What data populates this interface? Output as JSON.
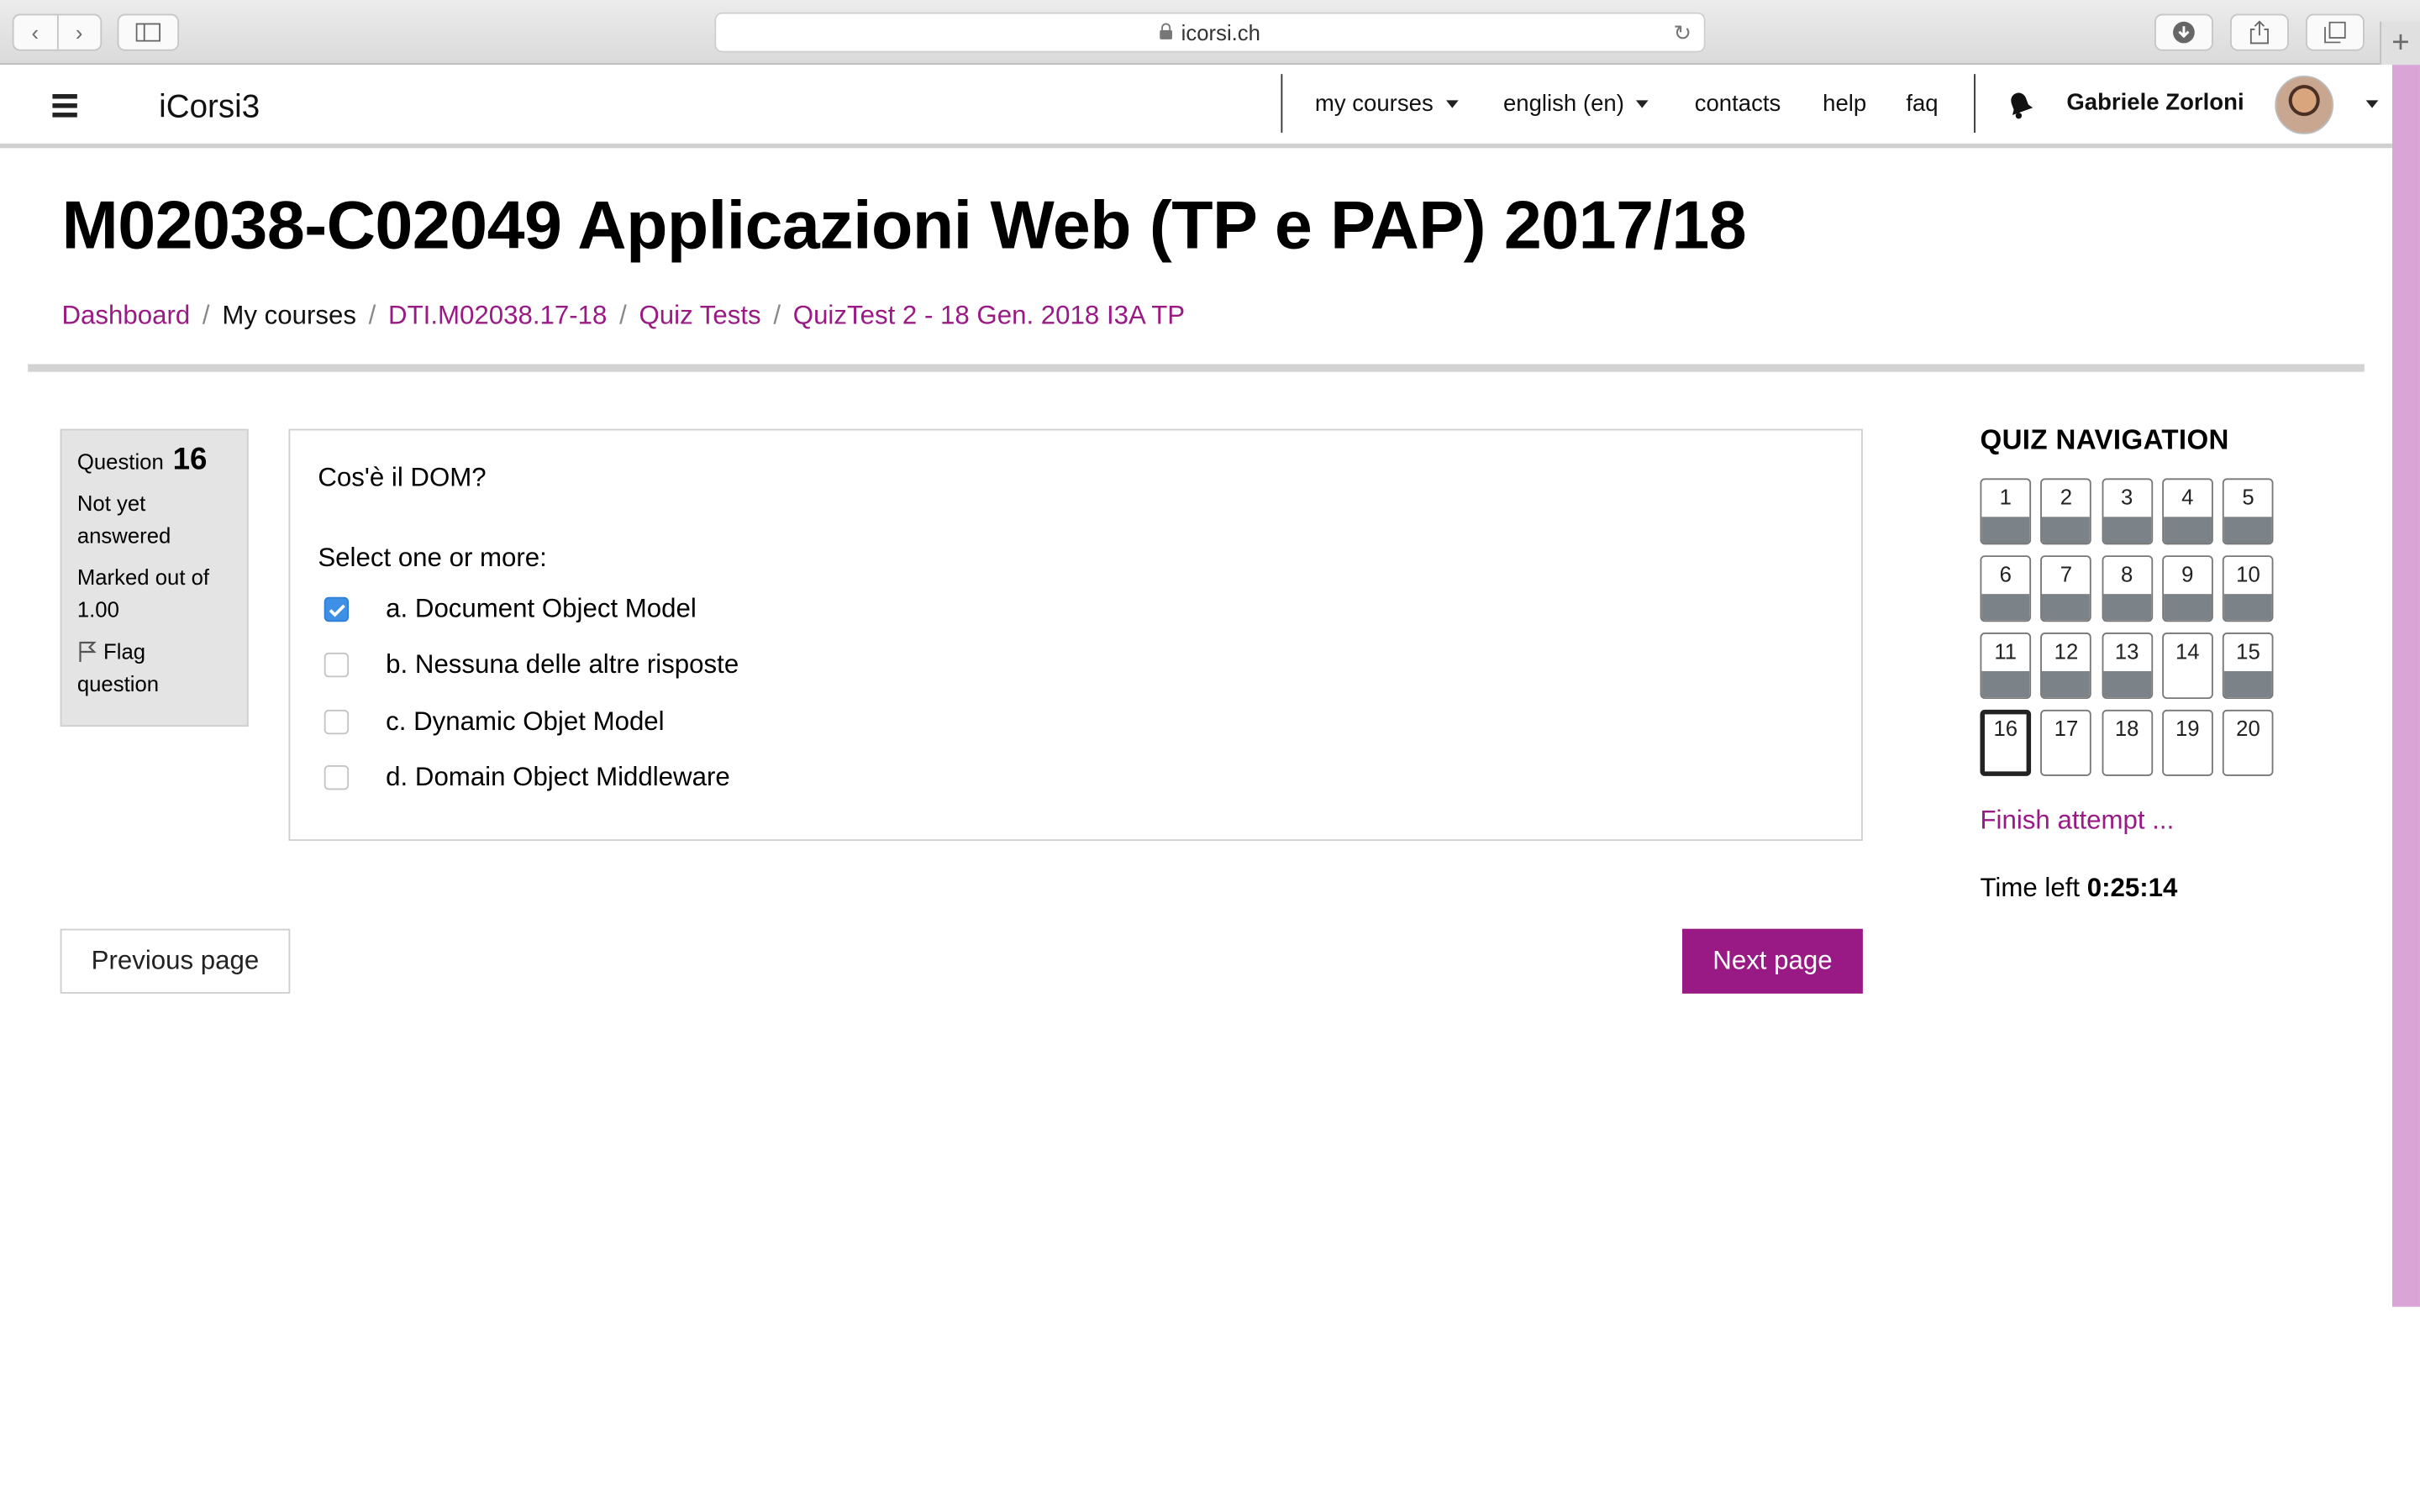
{
  "browser": {
    "url": "icorsi.ch"
  },
  "topnav": {
    "brand": "iCorsi3",
    "menu": [
      {
        "label": "my courses",
        "dropdown": true
      },
      {
        "label": "english (en)",
        "dropdown": true
      },
      {
        "label": "contacts",
        "dropdown": false
      },
      {
        "label": "help",
        "dropdown": false
      },
      {
        "label": "faq",
        "dropdown": false
      }
    ],
    "user_name": "Gabriele Zorloni"
  },
  "course": {
    "title": "M02038-C02049 Applicazioni Web (TP e PAP) 2017/18"
  },
  "breadcrumb": [
    {
      "label": "Dashboard",
      "link": true
    },
    {
      "label": "My courses",
      "link": false
    },
    {
      "label": "DTI.M02038.17-18",
      "link": true
    },
    {
      "label": "Quiz Tests",
      "link": true
    },
    {
      "label": "QuizTest 2 - 18 Gen. 2018 I3A TP",
      "link": true
    }
  ],
  "question_info": {
    "question_label": "Question",
    "number": "16",
    "status": "Not yet answered",
    "marked_label": "Marked out of",
    "marked_value": "1.00",
    "flag_label": "Flag question"
  },
  "question": {
    "text": "Cos'è il DOM?",
    "prompt": "Select one or more:",
    "options": [
      {
        "label": "a. Document Object Model",
        "checked": true
      },
      {
        "label": "b. Nessuna delle altre risposte",
        "checked": false
      },
      {
        "label": "c. Dynamic Objet Model",
        "checked": false
      },
      {
        "label": "d. Domain Object Middleware",
        "checked": false
      }
    ]
  },
  "buttons": {
    "previous": "Previous page",
    "next": "Next page"
  },
  "quiz_navigation": {
    "heading": "QUIZ NAVIGATION",
    "questions": [
      {
        "n": "1",
        "answered": true
      },
      {
        "n": "2",
        "answered": true
      },
      {
        "n": "3",
        "answered": true
      },
      {
        "n": "4",
        "answered": true
      },
      {
        "n": "5",
        "answered": true
      },
      {
        "n": "6",
        "answered": true
      },
      {
        "n": "7",
        "answered": true
      },
      {
        "n": "8",
        "answered": true
      },
      {
        "n": "9",
        "answered": true
      },
      {
        "n": "10",
        "answered": true
      },
      {
        "n": "11",
        "answered": true
      },
      {
        "n": "12",
        "answered": true
      },
      {
        "n": "13",
        "answered": true
      },
      {
        "n": "14",
        "answered": false
      },
      {
        "n": "15",
        "answered": true
      },
      {
        "n": "16",
        "answered": false,
        "current": true
      },
      {
        "n": "17",
        "answered": false
      },
      {
        "n": "18",
        "answered": false
      },
      {
        "n": "19",
        "answered": false
      },
      {
        "n": "20",
        "answered": false
      }
    ],
    "finish_label": "Finish attempt ...",
    "time_label": "Time left",
    "time_value": "0:25:14"
  },
  "colors": {
    "accent": "#9a1a85",
    "checkbox_checked": "#3d90e6",
    "answered_fill": "#7b8288"
  }
}
